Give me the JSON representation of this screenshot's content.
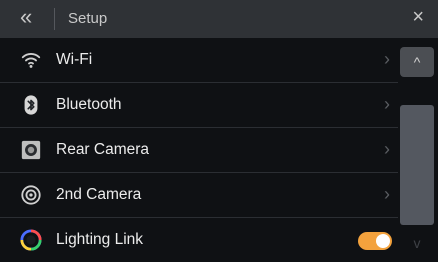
{
  "header": {
    "back_glyph": "«",
    "title": "Setup",
    "close_glyph": "×"
  },
  "items": [
    {
      "label": "Wi-Fi",
      "icon": "wifi-icon",
      "chevron": "›"
    },
    {
      "label": "Bluetooth",
      "icon": "bluetooth-icon",
      "chevron": "›"
    },
    {
      "label": "Rear Camera",
      "icon": "rear-camera-icon",
      "chevron": "›"
    },
    {
      "label": "2nd Camera",
      "icon": "camera-icon",
      "chevron": "›"
    },
    {
      "label": "Lighting Link",
      "icon": "lighting-link-icon",
      "toggle_on": true
    }
  ],
  "scrollbar": {
    "up_glyph": "^",
    "down_glyph": "v"
  },
  "colors": {
    "header_bg": "#2f3236",
    "toggle_on": "#f3a23d",
    "background": "#0f1114"
  }
}
